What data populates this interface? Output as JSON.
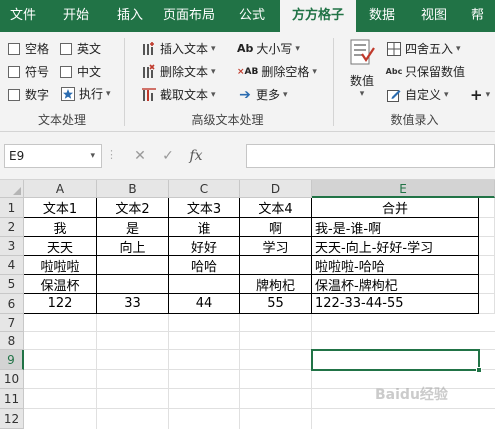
{
  "ribbon": {
    "tabs": [
      "文件",
      "开始",
      "插入",
      "页面布局",
      "公式",
      "方方格子",
      "数据",
      "视图",
      "帮"
    ],
    "active_tab": "方方格子",
    "accent_color": "#217346",
    "text_processing": {
      "label": "文本处理",
      "checkboxes": [
        "空格",
        "英文",
        "符号",
        "中文",
        "数字"
      ],
      "execute_label": "执行"
    },
    "advanced_text": {
      "label": "高级文本处理",
      "insert_text": "插入文本",
      "delete_text": "删除文本",
      "extract_text": "截取文本",
      "case": "大小写",
      "delete_space": "删除空格",
      "more": "更多"
    },
    "number_entry": {
      "label": "数值录入",
      "numeric": "数值",
      "round": "四舍五入",
      "keep_value": "只保留数值",
      "custom": "自定义"
    }
  },
  "formula_bar": {
    "name_box": "E9",
    "formula": ""
  },
  "sheet": {
    "columns": [
      "A",
      "B",
      "C",
      "D",
      "E"
    ],
    "rows": [
      "1",
      "2",
      "3",
      "4",
      "5",
      "6",
      "7",
      "8",
      "9",
      "10",
      "11",
      "12"
    ],
    "selected_cell": "E9",
    "cells": {
      "r1": [
        "文本1",
        "文本2",
        "文本3",
        "文本4",
        "合并"
      ],
      "r2": [
        "我",
        "是",
        "谁",
        "啊",
        "我-是-谁-啊"
      ],
      "r3": [
        "天天",
        "向上",
        "好好",
        "学习",
        "天天-向上-好好-学习"
      ],
      "r4": [
        "啦啦啦",
        "",
        "哈哈",
        "",
        "啦啦啦-哈哈"
      ],
      "r5": [
        "保温杯",
        "",
        "",
        "牌枸杞",
        "保温杯-牌枸杞"
      ],
      "r6": [
        "122",
        "33",
        "44",
        "55",
        "122-33-44-55"
      ]
    }
  },
  "watermark": "Baidu经验"
}
